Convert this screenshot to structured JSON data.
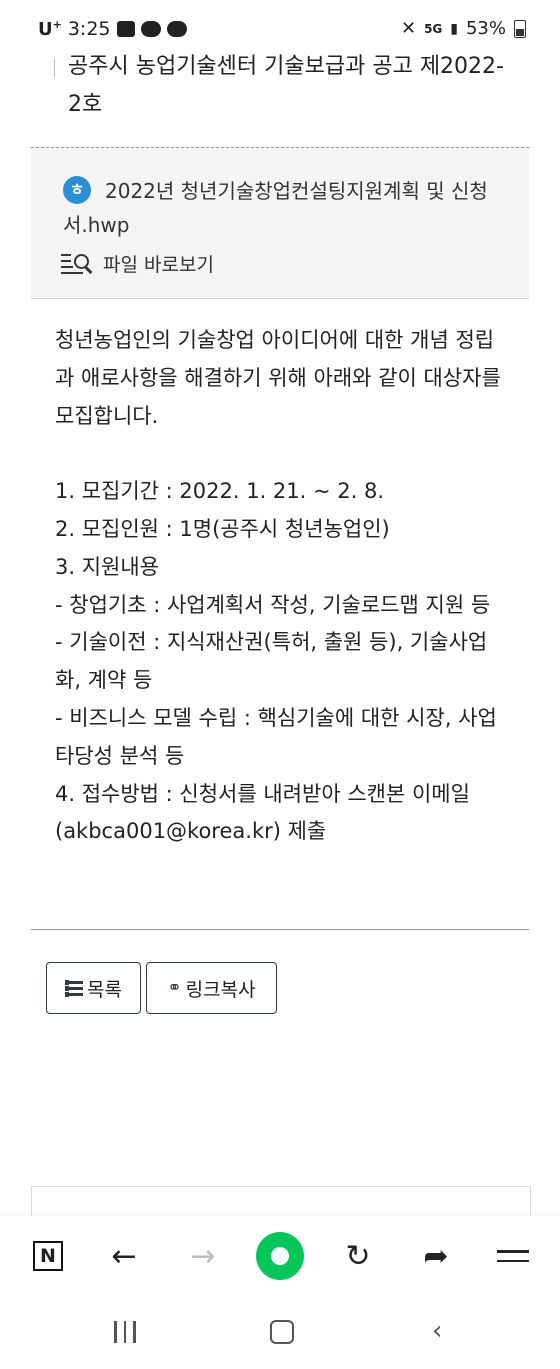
{
  "status_bar": {
    "carrier": "U",
    "carrier_plus": "+",
    "time": "3:25",
    "network": "5G",
    "battery": "53%"
  },
  "post": {
    "title": "공주시 농업기술센터 기술보급과 공고 제2022-2호"
  },
  "attachment": {
    "icon_letter": "ㅎ",
    "file_name": "2022년 청년기술창업컨설팅지원계획 및 신청서.hwp",
    "viewer_label": "파일 바로보기"
  },
  "body": {
    "intro": "청년농업인의 기술창업 아이디어에 대한 개념 정립과 애로사항을 해결하기 위해 아래와 같이 대상자를 모집합니다.",
    "lines": [
      "1. 모집기간 : 2022. 1. 21. ~ 2. 8.",
      "2. 모집인원 : 1명(공주시 청년농업인)",
      "3. 지원내용",
      "- 창업기초 : 사업계획서 작성, 기술로드맵 지원 등",
      "- 기술이전 : 지식재산권(특허, 출원 등), 기술사업화, 계약 등",
      "- 비즈니스 모델 수립 : 핵심기술에 대한 시장, 사업타당성 분석 등",
      "4. 접수방법 : 신청서를 내려받아 스캔본 이메일(akbca001@korea.kr) 제출"
    ]
  },
  "buttons": {
    "list_label": "목록",
    "copy_link_label": "링크복사"
  },
  "browser_toolbar": {
    "home_letter": "N",
    "back_glyph": "←",
    "forward_glyph": "→",
    "reload_glyph": "↻",
    "share_glyph": "➦"
  },
  "system_nav": {
    "back_glyph": "‹"
  }
}
